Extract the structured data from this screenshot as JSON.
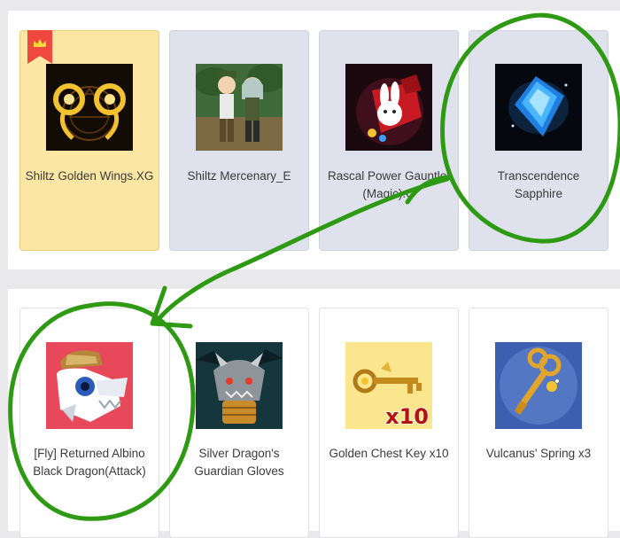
{
  "top_row": {
    "items": [
      {
        "name": "Shiltz Golden Wings.XG",
        "image": "golden-wings-icon",
        "featured": true,
        "badge_icon": "crown-icon"
      },
      {
        "name": "Shiltz Mercenary_E",
        "image": "mercenary-pair-icon"
      },
      {
        "name": "Rascal Power Gauntlet (Magic).G",
        "image": "bunny-gauntlet-icon"
      },
      {
        "name": "Transcendence Sapphire",
        "image": "blue-sapphire-icon"
      }
    ]
  },
  "bottom_row": {
    "items": [
      {
        "name": "[Fly] Returned Albino Black Dragon(Attack)",
        "image": "albino-dragon-icon"
      },
      {
        "name": "Silver Dragon's Guardian Gloves",
        "image": "dragon-gloves-icon"
      },
      {
        "name": "Golden Chest Key x10",
        "image": "golden-key-icon",
        "quantity_label": "x10"
      },
      {
        "name": "Vulcanus' Spring x3",
        "image": "spring-key-icon"
      }
    ]
  },
  "colors": {
    "featured_card": "#fbe6a3",
    "default_card": "#dfe1ec",
    "ribbon": "#f0473e",
    "annotation_green": "#2e9a14"
  }
}
